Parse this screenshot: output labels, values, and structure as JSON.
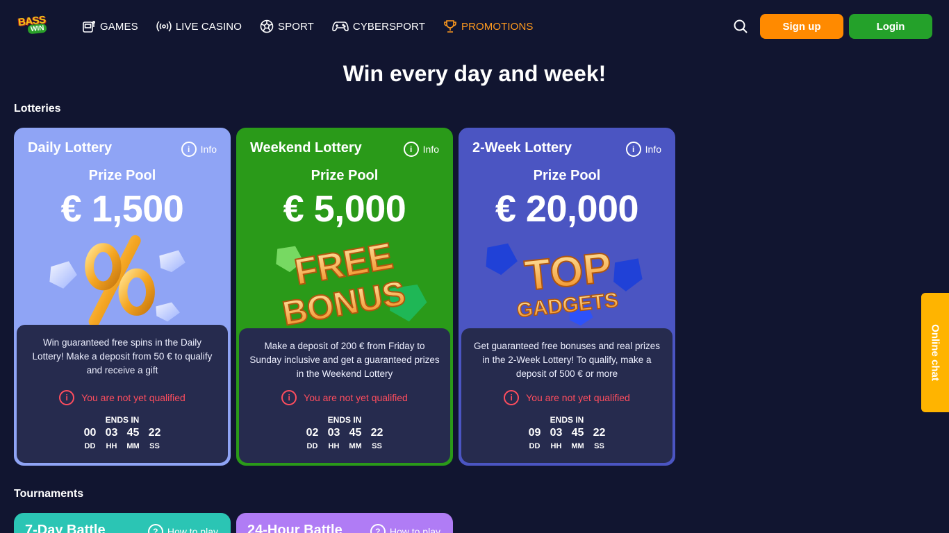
{
  "header": {
    "logo_top": "BASS",
    "logo_bottom": "WIN",
    "nav": [
      {
        "label": "GAMES",
        "icon": "slot-machine-icon"
      },
      {
        "label": "LIVE CASINO",
        "icon": "broadcast-icon"
      },
      {
        "label": "SPORT",
        "icon": "soccer-ball-icon"
      },
      {
        "label": "CYBERSPORT",
        "icon": "gamepad-icon"
      },
      {
        "label": "PROMOTIONS",
        "icon": "trophy-icon",
        "active": true
      }
    ],
    "signup_label": "Sign up",
    "login_label": "Login"
  },
  "page_title": "Win every day and week!",
  "lotteries_title": "Lotteries",
  "lotteries": [
    {
      "name": "Daily Lottery",
      "info_label": "Info",
      "pool_label": "Prize Pool",
      "pool_amount": "€ 1,500",
      "art": "percent-with-crystals",
      "description": "Win guaranteed free spins in the Daily Lottery! Make a deposit from 50 € to qualify and receive a gift",
      "status": "You are not yet qualified",
      "ends_label": "ENDS IN",
      "timer": {
        "dd": "00",
        "hh": "03",
        "mm": "45",
        "ss": "22"
      },
      "timer_labels": {
        "dd": "DD",
        "hh": "HH",
        "mm": "MM",
        "ss": "SS"
      },
      "color": "#8fa4f5"
    },
    {
      "name": "Weekend Lottery",
      "info_label": "Info",
      "pool_label": "Prize Pool",
      "pool_amount": "€ 5,000",
      "art_text_1": "FREE",
      "art_text_2": "BONUS",
      "description": "Make a deposit of 200 € from Friday to Sunday inclusive and get a guaranteed prizes in the Weekend Lottery",
      "status": "You are not yet qualified",
      "ends_label": "ENDS IN",
      "timer": {
        "dd": "02",
        "hh": "03",
        "mm": "45",
        "ss": "22"
      },
      "timer_labels": {
        "dd": "DD",
        "hh": "HH",
        "mm": "MM",
        "ss": "SS"
      },
      "color": "#2a9a19"
    },
    {
      "name": "2-Week Lottery",
      "info_label": "Info",
      "pool_label": "Prize Pool",
      "pool_amount": "€ 20,000",
      "art_text_1": "TOP",
      "art_text_2": "GADGETS",
      "description": "Get guaranteed free bonuses and real prizes in the 2-Week Lottery! To qualify, make a deposit of 500 € or more",
      "status": "You are not yet qualified",
      "ends_label": "ENDS IN",
      "timer": {
        "dd": "09",
        "hh": "03",
        "mm": "45",
        "ss": "22"
      },
      "timer_labels": {
        "dd": "DD",
        "hh": "HH",
        "mm": "MM",
        "ss": "SS"
      },
      "color": "#4b55c2"
    }
  ],
  "tournaments_title": "Tournaments",
  "tournaments": [
    {
      "name": "7-Day Battle",
      "help_label": "How to play",
      "color": "#2bc5b4"
    },
    {
      "name": "24-Hour Battle",
      "help_label": "How to play",
      "color": "#b07cf5"
    }
  ],
  "chat_label": "Online chat",
  "colors": {
    "background": "#111530",
    "accent_orange": "#ff8a00",
    "accent_green": "#24a12a",
    "warning_red": "#ff4d5e",
    "panel": "#262b4e"
  }
}
